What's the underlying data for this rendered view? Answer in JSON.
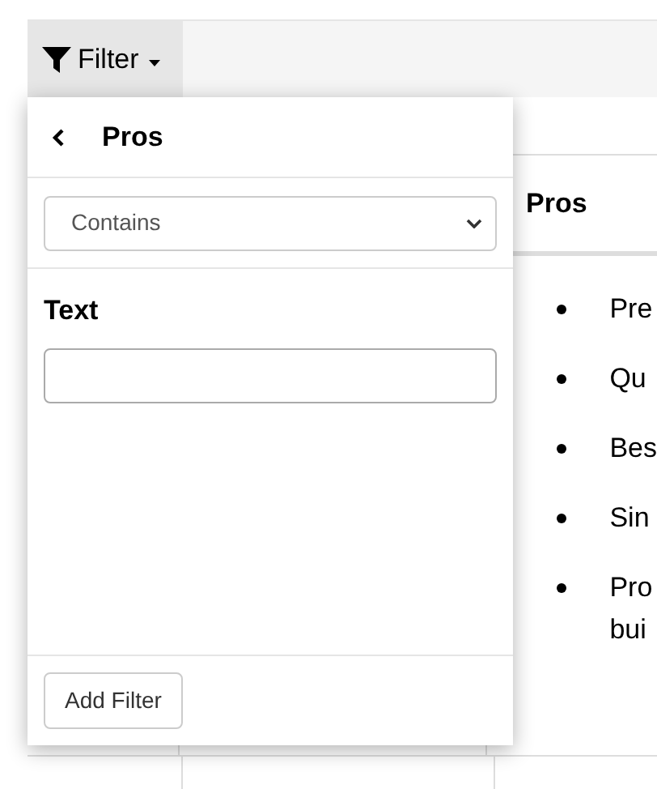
{
  "toolbar": {
    "filter_button": "Filter"
  },
  "table": {
    "columns": [
      {
        "label": "Pros"
      }
    ],
    "rows": [
      {
        "pros": [
          "Pre",
          "Qu",
          "Bes",
          "Sin",
          "Pro\nbui"
        ]
      }
    ]
  },
  "filter_popup": {
    "title": "Pros",
    "operator": {
      "value": "Contains"
    },
    "field_label": "Text",
    "button": "Add Filter"
  }
}
